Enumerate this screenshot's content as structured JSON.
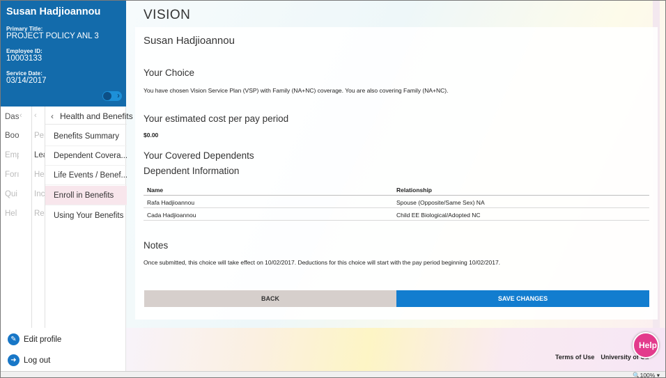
{
  "profile": {
    "name": "Susan Hadjioannou",
    "primary_title_label": "Primary Title:",
    "primary_title": "PROJECT POLICY ANL 3",
    "employee_id_label": "Employee ID:",
    "employee_id": "10003133",
    "service_date_label": "Service Date:",
    "service_date": "03/14/2017"
  },
  "nav_col1": [
    "Das",
    "Boo",
    "Emp",
    "Forı",
    "Qui",
    "Hel"
  ],
  "nav_col2": [
    "Per",
    "Lea",
    "Hea",
    "Inco",
    "Ret"
  ],
  "nav_col3": {
    "header": "Health and Benefits",
    "items": [
      "Benefits Summary",
      "Dependent Covera...",
      "Life Events / Benef...",
      "Enroll in Benefits",
      "Using Your Benefits"
    ],
    "active_index": 3
  },
  "bottom_links": {
    "edit_profile": "Edit profile",
    "log_out": "Log out"
  },
  "main": {
    "title": "VISION",
    "person": "Susan Hadjioannou",
    "your_choice_heading": "Your Choice",
    "your_choice_text": "You have chosen Vision Service Plan (VSP) with Family (NA+NC) coverage. You are also covering Family (NA+NC).",
    "cost_heading": "Your estimated cost per pay period",
    "cost_value": "$0.00",
    "covered_heading": "Your Covered Dependents",
    "dependent_info_heading": "Dependent Information",
    "table": {
      "headers": [
        "Name",
        "Relationship"
      ],
      "rows": [
        [
          "Rafa Hadjioannou",
          "Spouse (Opposite/Same Sex) NA"
        ],
        [
          "Cada Hadjioannou",
          "Child EE Biological/Adopted NC"
        ]
      ]
    },
    "notes_heading": "Notes",
    "notes_text": "Once submitted, this choice will take effect on 10/02/2017. Deductions for this choice will start with the pay period beginning 10/02/2017.",
    "back_label": "BACK",
    "save_label": "SAVE CHANGES"
  },
  "footer": {
    "terms": "Terms of Use",
    "university": "University of Ca",
    "help": "Help"
  },
  "statusbar": {
    "zoom": "100%"
  },
  "colors": {
    "brand_blue": "#136bab",
    "save_button": "#127dcf",
    "back_button": "#d6cfcc",
    "help_pink": "#e33b8c",
    "active_item": "#f8e6ec"
  }
}
